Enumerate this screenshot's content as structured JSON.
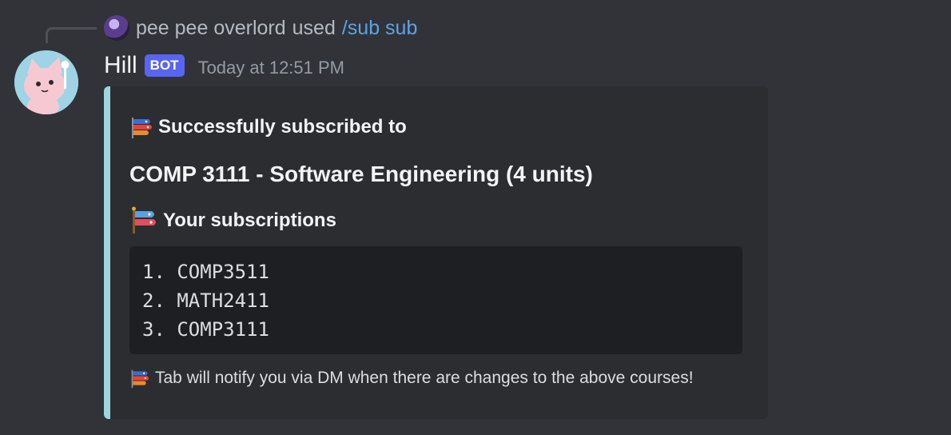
{
  "reply": {
    "username": "pee pee overlord",
    "used_text": "used",
    "command": "/sub sub"
  },
  "message": {
    "username": "Hill",
    "bot_tag": "BOT",
    "timestamp": "Today at 12:51 PM"
  },
  "embed": {
    "accent_color": "#9dd6e0",
    "title": "Successfully subscribed to",
    "title_icon": "carp-streamer-icon",
    "course": "COMP 3111 - Software Engineering (4 units)",
    "subs_title": "Your subscriptions",
    "subs_icon": "carp-streamer-icon",
    "subscriptions": [
      "1. COMP3511",
      "2. MATH2411",
      "3. COMP3111"
    ],
    "footer": "Tab will notify you via DM when there are changes to the above courses!",
    "footer_icon": "carp-streamer-icon"
  },
  "colors": {
    "background": "#313338",
    "bot_tag": "#5865f2",
    "command_link": "#5ea2e6"
  }
}
